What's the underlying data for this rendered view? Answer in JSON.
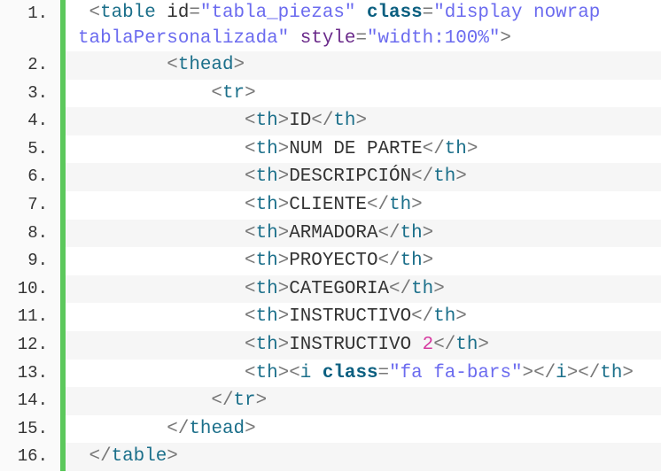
{
  "code": {
    "colors": {
      "gutter_border": "#5cc85c",
      "string": "#6b6bef",
      "keyword": "#0b5f80",
      "number": "#d63aa0"
    },
    "lines": [
      {
        "number": "1.",
        "rows": [
          [
            [
              "punct",
              " <"
            ],
            [
              "tag",
              "table"
            ],
            [
              "attr",
              " id"
            ],
            [
              "punct",
              "="
            ],
            [
              "str",
              "\"tabla_piezas\""
            ],
            [
              "attr",
              " "
            ],
            [
              "kw",
              "class"
            ],
            [
              "punct",
              "="
            ],
            [
              "str",
              "\"display nowrap"
            ]
          ],
          [
            [
              "str",
              "tablaPersonalizada\""
            ],
            [
              "attr",
              " "
            ],
            [
              "attr2",
              "style"
            ],
            [
              "punct",
              "="
            ],
            [
              "str",
              "\"width:100%\""
            ],
            [
              "punct",
              ">"
            ]
          ]
        ]
      },
      {
        "number": "2.",
        "rows": [
          [
            [
              "punct",
              "        <"
            ],
            [
              "tag",
              "thead"
            ],
            [
              "punct",
              ">"
            ]
          ]
        ]
      },
      {
        "number": "3.",
        "rows": [
          [
            [
              "punct",
              "            <"
            ],
            [
              "tag",
              "tr"
            ],
            [
              "punct",
              ">"
            ]
          ]
        ]
      },
      {
        "number": "4.",
        "rows": [
          [
            [
              "punct",
              "               <"
            ],
            [
              "tag",
              "th"
            ],
            [
              "punct",
              ">"
            ],
            [
              "text",
              "ID"
            ],
            [
              "punct",
              "</"
            ],
            [
              "tag",
              "th"
            ],
            [
              "punct",
              ">"
            ]
          ]
        ]
      },
      {
        "number": "5.",
        "rows": [
          [
            [
              "punct",
              "               <"
            ],
            [
              "tag",
              "th"
            ],
            [
              "punct",
              ">"
            ],
            [
              "text",
              "NUM DE PARTE"
            ],
            [
              "punct",
              "</"
            ],
            [
              "tag",
              "th"
            ],
            [
              "punct",
              ">"
            ]
          ]
        ]
      },
      {
        "number": "6.",
        "rows": [
          [
            [
              "punct",
              "               <"
            ],
            [
              "tag",
              "th"
            ],
            [
              "punct",
              ">"
            ],
            [
              "text",
              "DESCRIPCIÓN"
            ],
            [
              "punct",
              "</"
            ],
            [
              "tag",
              "th"
            ],
            [
              "punct",
              ">"
            ]
          ]
        ]
      },
      {
        "number": "7.",
        "rows": [
          [
            [
              "punct",
              "               <"
            ],
            [
              "tag",
              "th"
            ],
            [
              "punct",
              ">"
            ],
            [
              "text",
              "CLIENTE"
            ],
            [
              "punct",
              "</"
            ],
            [
              "tag",
              "th"
            ],
            [
              "punct",
              ">"
            ]
          ]
        ]
      },
      {
        "number": "8.",
        "rows": [
          [
            [
              "punct",
              "               <"
            ],
            [
              "tag",
              "th"
            ],
            [
              "punct",
              ">"
            ],
            [
              "text",
              "ARMADORA"
            ],
            [
              "punct",
              "</"
            ],
            [
              "tag",
              "th"
            ],
            [
              "punct",
              ">"
            ]
          ]
        ]
      },
      {
        "number": "9.",
        "rows": [
          [
            [
              "punct",
              "               <"
            ],
            [
              "tag",
              "th"
            ],
            [
              "punct",
              ">"
            ],
            [
              "text",
              "PROYECTO"
            ],
            [
              "punct",
              "</"
            ],
            [
              "tag",
              "th"
            ],
            [
              "punct",
              ">"
            ]
          ]
        ]
      },
      {
        "number": "10.",
        "rows": [
          [
            [
              "punct",
              "               <"
            ],
            [
              "tag",
              "th"
            ],
            [
              "punct",
              ">"
            ],
            [
              "text",
              "CATEGORIA"
            ],
            [
              "punct",
              "</"
            ],
            [
              "tag",
              "th"
            ],
            [
              "punct",
              ">"
            ]
          ]
        ]
      },
      {
        "number": "11.",
        "rows": [
          [
            [
              "punct",
              "               <"
            ],
            [
              "tag",
              "th"
            ],
            [
              "punct",
              ">"
            ],
            [
              "text",
              "INSTRUCTIVO"
            ],
            [
              "punct",
              "</"
            ],
            [
              "tag",
              "th"
            ],
            [
              "punct",
              ">"
            ]
          ]
        ]
      },
      {
        "number": "12.",
        "rows": [
          [
            [
              "punct",
              "               <"
            ],
            [
              "tag",
              "th"
            ],
            [
              "punct",
              ">"
            ],
            [
              "text",
              "INSTRUCTIVO "
            ],
            [
              "num",
              "2"
            ],
            [
              "punct",
              "</"
            ],
            [
              "tag",
              "th"
            ],
            [
              "punct",
              ">"
            ]
          ]
        ]
      },
      {
        "number": "13.",
        "rows": [
          [
            [
              "punct",
              "               <"
            ],
            [
              "tag",
              "th"
            ],
            [
              "punct",
              ">"
            ],
            [
              "punct",
              "<"
            ],
            [
              "tag",
              "i"
            ],
            [
              "attr",
              " "
            ],
            [
              "kw",
              "class"
            ],
            [
              "punct",
              "="
            ],
            [
              "str",
              "\"fa fa-bars\""
            ],
            [
              "punct",
              "></"
            ],
            [
              "tag",
              "i"
            ],
            [
              "punct",
              "></"
            ],
            [
              "tag",
              "th"
            ],
            [
              "punct",
              ">"
            ]
          ]
        ]
      },
      {
        "number": "14.",
        "rows": [
          [
            [
              "punct",
              "            </"
            ],
            [
              "tag",
              "tr"
            ],
            [
              "punct",
              ">"
            ]
          ]
        ]
      },
      {
        "number": "15.",
        "rows": [
          [
            [
              "punct",
              "        </"
            ],
            [
              "tag",
              "thead"
            ],
            [
              "punct",
              ">"
            ]
          ]
        ]
      },
      {
        "number": "16.",
        "rows": [
          [
            [
              "punct",
              " </"
            ],
            [
              "tag",
              "table"
            ],
            [
              "punct",
              ">"
            ]
          ]
        ]
      }
    ]
  }
}
